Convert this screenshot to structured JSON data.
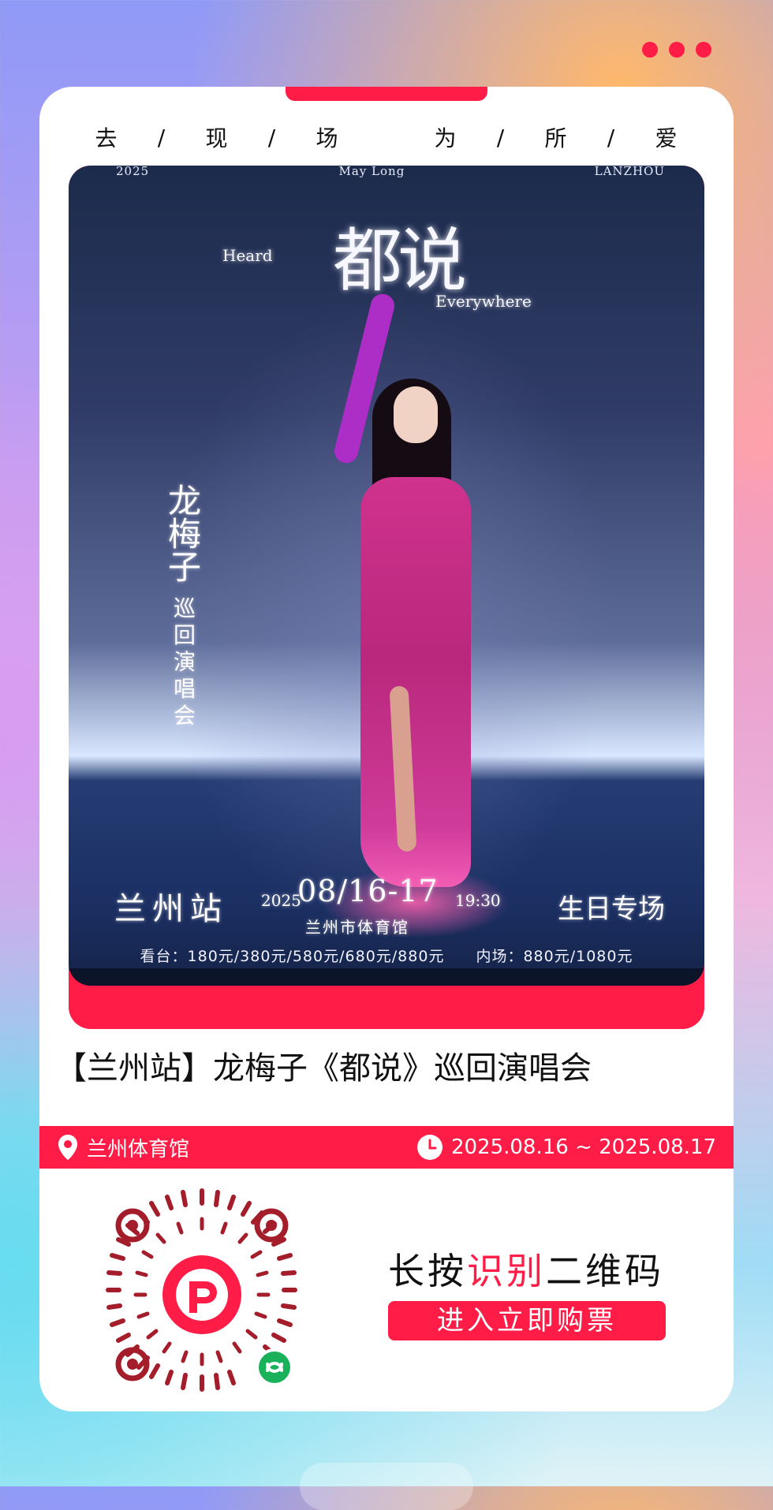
{
  "page": {
    "accent": "#ff1c46"
  },
  "slogan": {
    "words": [
      "去",
      "现",
      "场",
      "为",
      "所",
      "爱"
    ],
    "separator": "/"
  },
  "poster": {
    "top_left": "2025",
    "top_center": "May Long",
    "top_right": "LANZHOU",
    "logo_cn": "都说",
    "logo_en_left": "Heard",
    "logo_en_right": "Everywhere",
    "artist_name": "龙梅子",
    "tour_name": "巡回演唱会",
    "city": "兰州站",
    "year": "2025",
    "date": "08/16-17",
    "time": "19:30",
    "venue": "兰州市体育馆",
    "special": "生日专场",
    "prices": "看台：180元/380元/580元/680元/880元　　内场：880元/1080元"
  },
  "event": {
    "title": "【兰州站】龙梅子《都说》巡回演唱会",
    "location": "兰州体育馆",
    "date_range": "2025.08.16 ~ 2025.08.17"
  },
  "qr": {
    "line1_prefix": "长按",
    "line1_highlight": "识别",
    "line1_suffix": "二维码",
    "button": "进入立即购票"
  },
  "icons": {
    "menu": "more-dots-icon",
    "location": "location-pin-icon",
    "clock": "clock-icon",
    "qr": "mini-program-qr-code",
    "badge": "mini-program-link-icon"
  }
}
